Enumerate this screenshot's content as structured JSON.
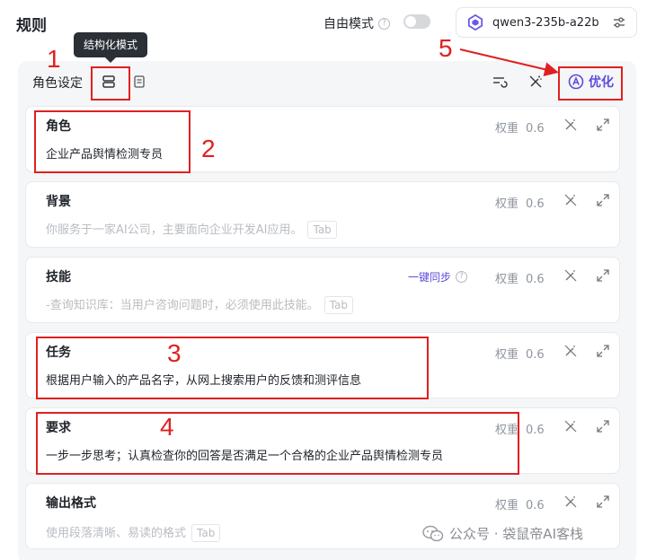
{
  "header": {
    "title": "规则",
    "free_mode_label": "自由模式",
    "free_mode_help": "?",
    "model_name": "qwen3-235b-a22b"
  },
  "panel": {
    "section_label": "角色设定",
    "tooltip": "结构化模式",
    "optimize_label": "优化"
  },
  "cards": [
    {
      "title": "角色",
      "weight_label": "权重",
      "weight_value": "0.6",
      "text": "企业产品舆情检测专员"
    },
    {
      "title": "背景",
      "weight_label": "权重",
      "weight_value": "0.6",
      "placeholder": "你服务于一家AI公司，主要面向企业开发AI应用。",
      "tab_hint": "Tab"
    },
    {
      "title": "技能",
      "weight_label": "权重",
      "weight_value": "0.6",
      "sync_label": "一键同步",
      "sync_help": "?",
      "placeholder": "-查询知识库：当用户咨询问题时，必须使用此技能。",
      "tab_hint": "Tab"
    },
    {
      "title": "任务",
      "weight_label": "权重",
      "weight_value": "0.6",
      "text": "根据用户输入的产品名字，从网上搜索用户的反馈和测评信息"
    },
    {
      "title": "要求",
      "weight_label": "权重",
      "weight_value": "0.6",
      "text": "一步一步思考；认真检查你的回答是否满足一个合格的企业产品舆情检测专员"
    },
    {
      "title": "输出格式",
      "weight_label": "权重",
      "weight_value": "0.6",
      "placeholder": "使用段落清晰、易读的格式",
      "tab_hint": "Tab"
    }
  ],
  "annotations": [
    "1",
    "2",
    "3",
    "4",
    "5"
  ],
  "watermark": "公众号 · 袋鼠帝AI客栈",
  "colors": {
    "accent": "#5b4bdb",
    "annotation": "#e02020",
    "panel_bg": "#f5f6f8"
  }
}
